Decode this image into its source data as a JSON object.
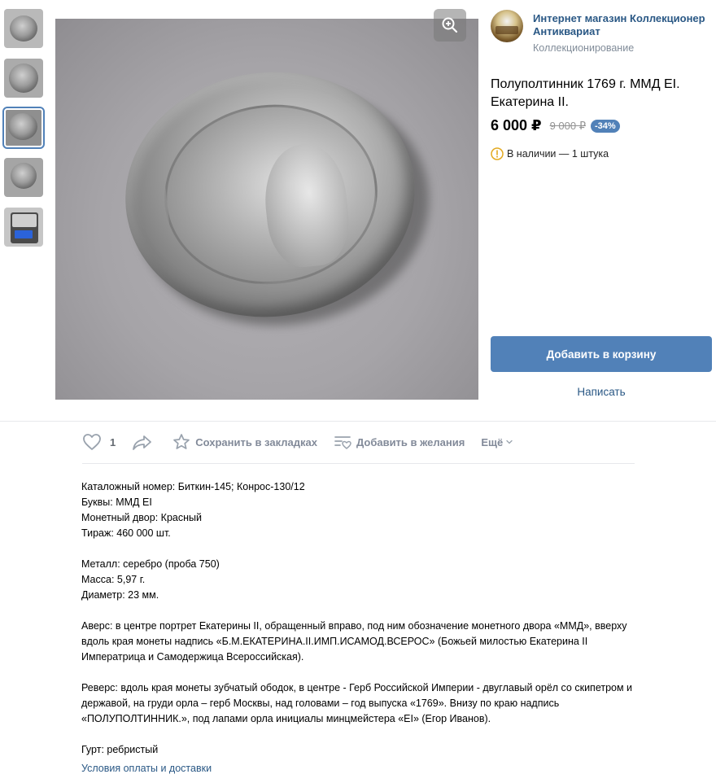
{
  "thumbnails": [
    {
      "name": "thumb-1",
      "active": false
    },
    {
      "name": "thumb-2",
      "active": false
    },
    {
      "name": "thumb-3",
      "active": true
    },
    {
      "name": "thumb-4",
      "active": false
    },
    {
      "name": "thumb-5",
      "active": false
    }
  ],
  "seller": {
    "name": "Интернет магазин Коллекционер Антиквариат",
    "category": "Коллекционирование"
  },
  "product": {
    "title": "Полуполтинник 1769 г. ММД ЕI. Екатерина II.",
    "price": "6 000 ₽",
    "old_price": "9 000 ₽",
    "discount": "-34%",
    "stock": "В наличии — 1 штука"
  },
  "buttons": {
    "add_to_cart": "Добавить в корзину",
    "write": "Написать"
  },
  "actions": {
    "like_count": "1",
    "bookmark": "Сохранить в закладках",
    "wishlist": "Добавить в желания",
    "more": "Ещё"
  },
  "description": {
    "catalog": "Каталожный номер: Биткин-145; Конрос-130/12",
    "letters": "Буквы: ММД ЕI",
    "mint": "Монетный двор: Красный",
    "mintage": "Тираж: 460 000 шт.",
    "metal": "Металл: серебро (проба 750)",
    "mass": "Масса: 5,97 г.",
    "diameter": "Диаметр: 23 мм.",
    "obverse": "Аверс: в центре портрет Екатерины II, обращенный вправо, под ним обозначение монетного двора «ММД», вверху вдоль края монеты надпись «Б.М.ЕКАТЕРИНА.II.ИМП.ИСАМОД.ВСЕРОС» (Божьей милостью Екатерина II Императрица и Самодержица Всероссийская).",
    "reverse": "Реверс: вдоль края монеты зубчатый ободок, в центре - Герб Российской Империи - двуглавый орёл со скипетром и державой, на груди орла – герб Москвы, над головами – год выпуска «1769». Внизу по краю надпись «ПОЛУПОЛТИННИК.», под лапами орла инициалы минцмейстера «ЕI» (Егор Иванов).",
    "edge": "Гурт: ребристый"
  },
  "links": {
    "payment_delivery": "Условия оплаты и доставки"
  },
  "colors": {
    "accent": "#5181b8",
    "link": "#2a5885",
    "muted": "#828a99",
    "stock_warning": "#e3a920"
  }
}
